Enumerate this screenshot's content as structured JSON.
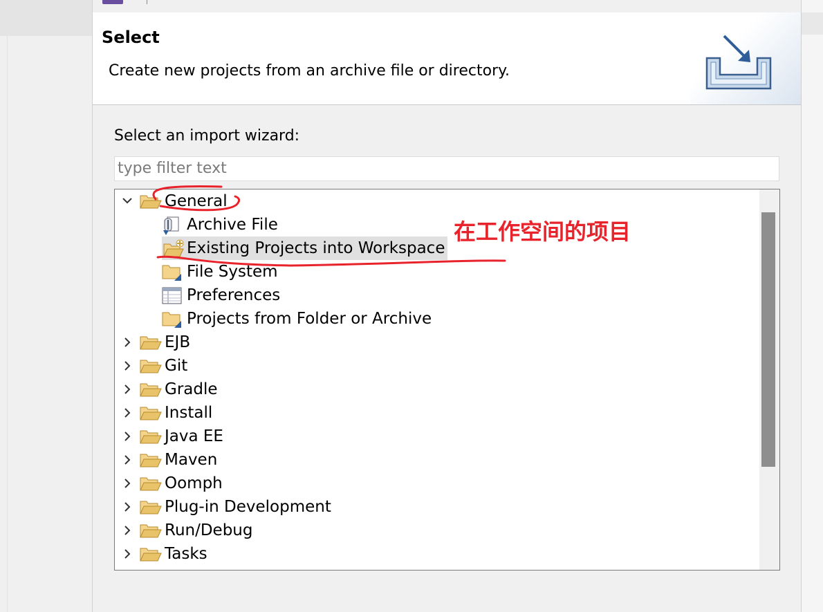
{
  "banner": {
    "title": "Select",
    "description": "Create new projects from an archive file or directory."
  },
  "wizard": {
    "label": "Select an import wizard:",
    "filter_placeholder": "type filter text"
  },
  "tree": {
    "items": [
      {
        "label": "General",
        "expanded": true,
        "icon": "folder-open-icon"
      },
      {
        "label": "Archive File",
        "icon": "archive-file-icon"
      },
      {
        "label": "Existing Projects into Workspace",
        "icon": "existing-projects-icon",
        "selected": true
      },
      {
        "label": "File System",
        "icon": "folder-icon"
      },
      {
        "label": "Preferences",
        "icon": "preferences-icon"
      },
      {
        "label": "Projects from Folder or Archive",
        "icon": "folder-icon"
      },
      {
        "label": "EJB",
        "expanded": false,
        "icon": "folder-open-icon"
      },
      {
        "label": "Git",
        "expanded": false,
        "icon": "folder-open-icon"
      },
      {
        "label": "Gradle",
        "expanded": false,
        "icon": "folder-open-icon"
      },
      {
        "label": "Install",
        "expanded": false,
        "icon": "folder-open-icon"
      },
      {
        "label": "Java EE",
        "expanded": false,
        "icon": "folder-open-icon"
      },
      {
        "label": "Maven",
        "expanded": false,
        "icon": "folder-open-icon"
      },
      {
        "label": "Oomph",
        "expanded": false,
        "icon": "folder-open-icon"
      },
      {
        "label": "Plug-in Development",
        "expanded": false,
        "icon": "folder-open-icon"
      },
      {
        "label": "Run/Debug",
        "expanded": false,
        "icon": "folder-open-icon"
      },
      {
        "label": "Tasks",
        "expanded": false,
        "icon": "folder-open-icon"
      }
    ]
  },
  "annotation": {
    "text": "在工作空间的项目",
    "color": "#e8232b"
  },
  "colors": {
    "folder": "#e9c36a",
    "selection": "#e0e0e0",
    "annotation_red": "#e8232b"
  }
}
